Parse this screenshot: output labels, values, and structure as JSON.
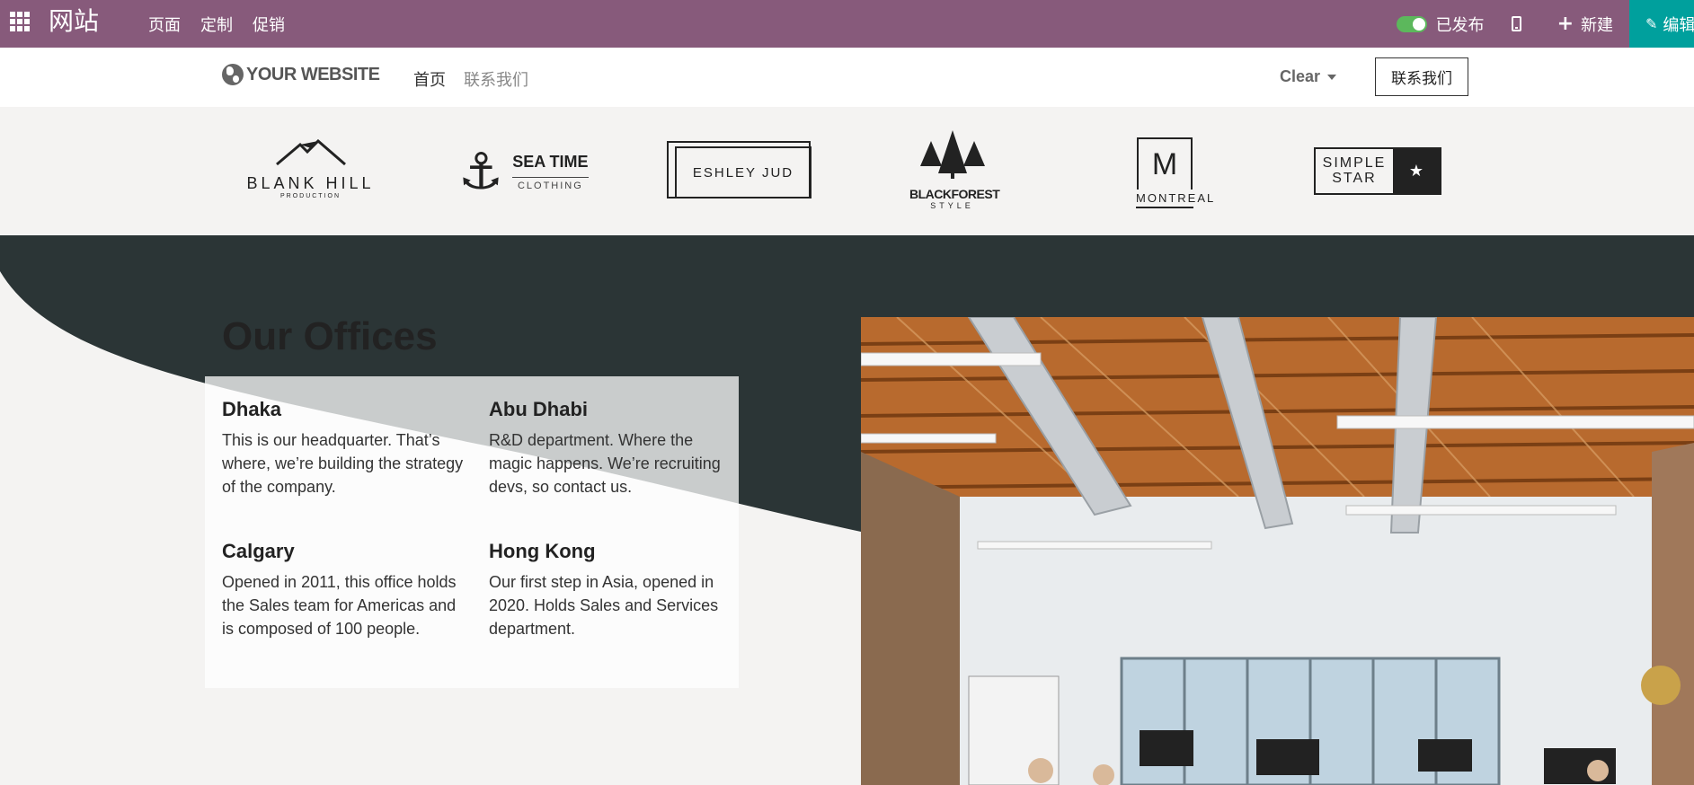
{
  "topbar": {
    "app_name": "网站",
    "menu": [
      "页面",
      "定制",
      "促销"
    ],
    "published_label": "已发布",
    "new_label": "新建",
    "edit_label": "编辑",
    "color": "#875a7b",
    "edit_color": "#00a09d"
  },
  "header": {
    "logo_text": "YOUR WEBSITE",
    "nav": [
      "首页",
      "联系我们"
    ],
    "clear_label": "Clear",
    "contact_button": "联系我们"
  },
  "logos": {
    "blank_hill": {
      "title": "BLANK HILL",
      "subtitle": "PRODUCTION"
    },
    "sea_time": {
      "title": "SEA TIME",
      "subtitle": "CLOTHING"
    },
    "eshley_jud": {
      "title": "ESHLEY JUD"
    },
    "blackforest": {
      "title": "BLACKFOREST",
      "subtitle": "STYLE"
    },
    "montreal": {
      "letter": "M",
      "title": "MONTREAL"
    },
    "simple_star": {
      "line1": "SIMPLE",
      "line2": "STAR"
    }
  },
  "offices": {
    "title": "Our Offices",
    "items": [
      {
        "city": "Dhaka",
        "text": "This is our headquarter. That’s where, we’re building the strategy of the company."
      },
      {
        "city": "Abu Dhabi",
        "text": "R&D department. Where the magic happens. We’re recruiting devs, so contact us."
      },
      {
        "city": "Calgary",
        "text": "Opened in 2011, this office holds the Sales team for Americas and is composed of 100 people."
      },
      {
        "city": "Hong Kong",
        "text": "Our first step in Asia, opened in 2020. Holds Sales and Services department."
      }
    ],
    "dark_color": "#2b3536",
    "light_color": "#f4f3f2"
  }
}
